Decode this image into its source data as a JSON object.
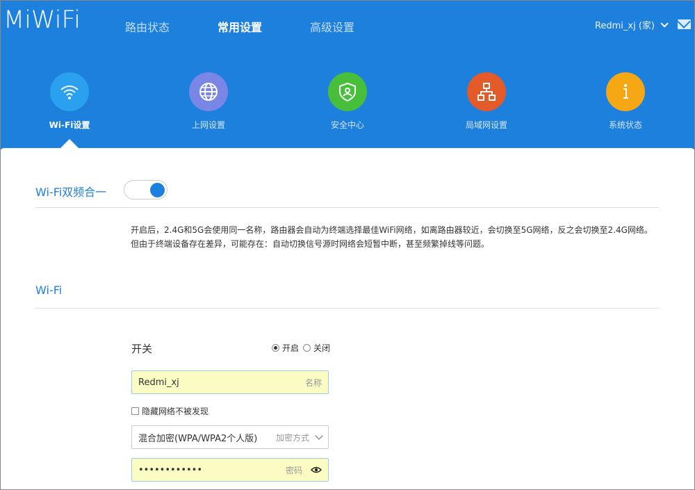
{
  "header": {
    "logo": "MiWiFi",
    "nav": [
      "路由状态",
      "常用设置",
      "高级设置"
    ],
    "active_nav": "常用设置",
    "user": "Redmi_xj (家)"
  },
  "categories": [
    {
      "label": "Wi-Fi设置",
      "icon": "wifi-icon",
      "color": "#2aa0ee",
      "active": true
    },
    {
      "label": "上网设置",
      "icon": "globe-icon",
      "color": "#7a86e6"
    },
    {
      "label": "安全中心",
      "icon": "shield-icon",
      "color": "#47bf3a"
    },
    {
      "label": "局域网设置",
      "icon": "network-icon",
      "color": "#e45a29"
    },
    {
      "label": "系统状态",
      "icon": "info-icon",
      "color": "#f6a814"
    }
  ],
  "dualband": {
    "title": "Wi-Fi双频合一",
    "enabled": true,
    "desc_line1": "开启后，2.4G和5G会使用同一名称，路由器会自动为终端选择最佳WiFi网络，如离路由器较近，会切换至5G网络，反之会切换至2.4G网络。",
    "desc_line2": "但由于终端设备存在差异，可能存在：自动切换信号源时网络会短暂中断，甚至频繁掉线等问题。"
  },
  "wifi": {
    "title": "Wi-Fi",
    "switch_label": "开关",
    "on_label": "开启",
    "off_label": "关闭",
    "ssid_value": "Redmi_xj",
    "ssid_hint": "名称",
    "hide_label": "隐藏网络不被发现",
    "encryption_value": "混合加密(WPA/WPA2个人版)",
    "encryption_hint": "加密方式",
    "password_value": "••••••••••••",
    "password_hint": "密码"
  },
  "colors": {
    "accent": "#1e80dd",
    "input_autofill": "#fafcc4"
  }
}
